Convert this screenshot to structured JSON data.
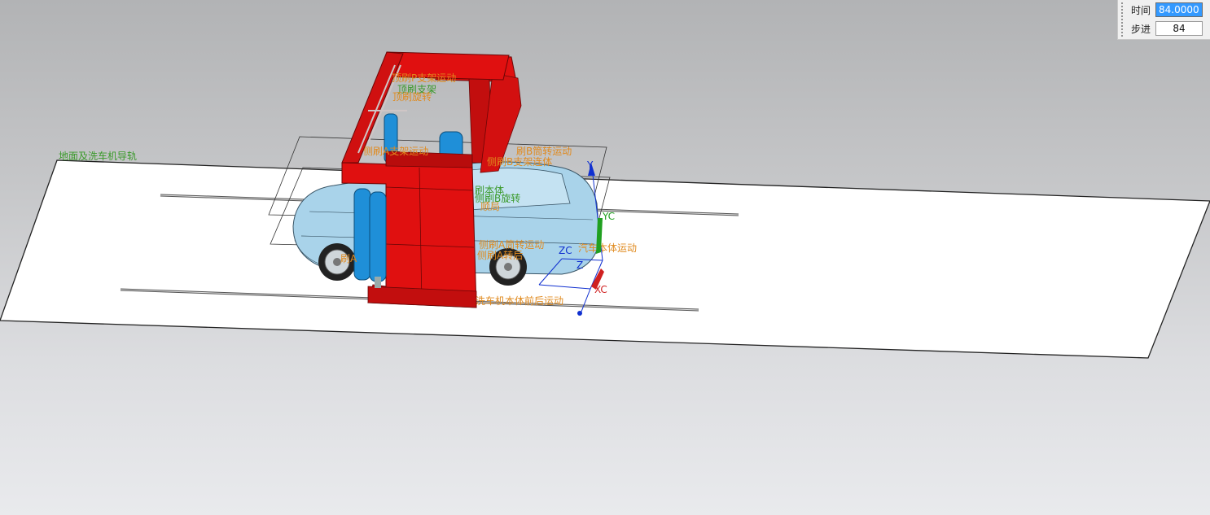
{
  "sim_panel": {
    "time_label": "时间",
    "time_value": "84.000000",
    "step_label": "步进",
    "step_value": "84"
  },
  "scene_labels": {
    "ground_rail": "地面及洗车机导轨",
    "top_brush_bracket_motion": "顶刷P支架运动",
    "top_brush_bracket": "顶刷支架",
    "top_brush_rotation": "顶刷旋转",
    "side_brush_bracket_motion": "侧刷A支架运动",
    "side_brush_b": "刷B筒转运动",
    "body_cluster": "侧刷B支架连体",
    "body_a": "刷本体",
    "rotation_label": "侧刷B旋转",
    "rotation_b": "顺局",
    "car_body_motion": "汽车本体运动",
    "brush_cluster_lower": "侧刷A筒转运动",
    "brush_cluster_lower2": "侧刷A转后",
    "brush_a_label": "刷A",
    "washer_body_motion": "洗车机本体前后运动",
    "axis_yc": "YC",
    "axis_xc": "XC",
    "axis_zc": "ZC",
    "axis_y": "Y",
    "axis_z": "Z"
  },
  "colors": {
    "frame_red": "#e01010",
    "frame_dark": "#8f0a0a",
    "brush_blue": "#1f8fd8",
    "car_body": "#a9d3ea",
    "label_orange": "#e08a1e",
    "label_green": "#3a9a2a",
    "axis_blue": "#1030d0",
    "axis_red": "#d02020",
    "axis_green": "#20a020",
    "selection_blue": "#3399ff"
  }
}
